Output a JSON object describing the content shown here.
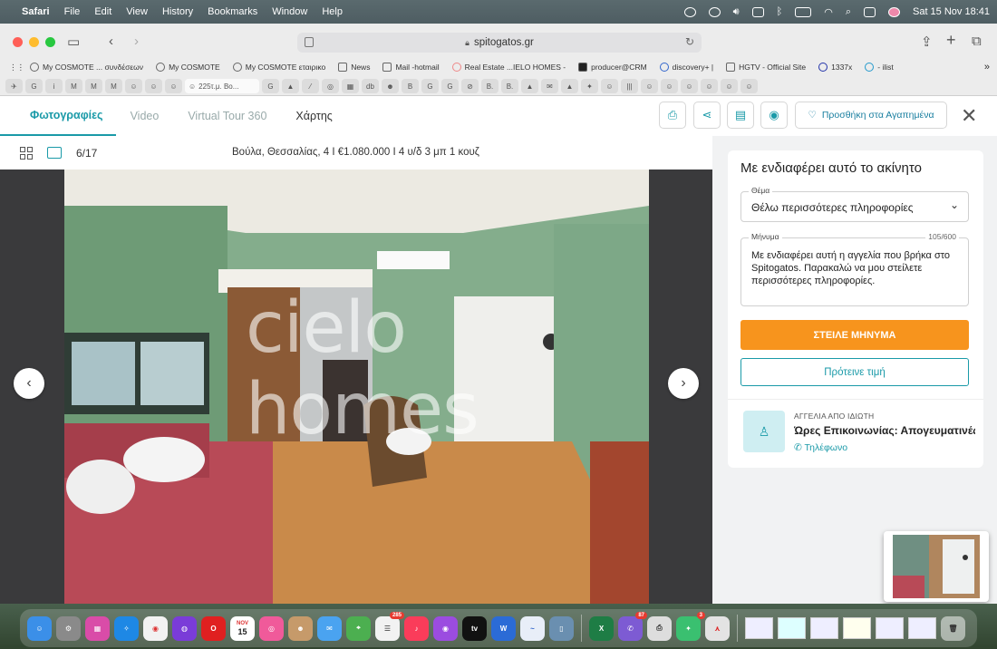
{
  "menubar": {
    "app": "Safari",
    "menus": [
      "File",
      "Edit",
      "View",
      "History",
      "Bookmarks",
      "Window",
      "Help"
    ],
    "datetime": "Sat 15 Nov  18:41"
  },
  "browser": {
    "url": "spitogatos.gr",
    "bookmarks": [
      "My COSMOTE ... συνδέσεων",
      "My COSMOTE",
      "My COSMOTE εταιρικο",
      "News",
      "Mail -hotmail",
      "Real Estate ...IELO HOMES -",
      "producer@CRM",
      "discovery+ |",
      "HGTV - Official Site",
      "1337x",
      "- ilist"
    ],
    "active_tab": "225τ.μ. Βο...",
    "tab_icons": [
      "G",
      "i",
      "M",
      "M",
      "M",
      "☺",
      "☺",
      "☺",
      "G",
      "▲",
      "⁄",
      "◎",
      "▦",
      "db",
      "☻",
      "B",
      "G",
      "G",
      "⊘",
      "B.",
      "B.",
      "▲",
      "✉",
      "▲",
      "✦",
      "☺",
      "|||",
      "☺",
      "☺",
      "☺",
      "☺",
      "☺",
      "☺"
    ]
  },
  "gallery": {
    "tabs": [
      "Φωτογραφίες",
      "Video",
      "Virtual Tour 360",
      "Χάρτης"
    ],
    "favorite_label": "Προσθήκη στα Αγαπημένα",
    "counter": "6/17",
    "summary": "Βούλα, Θεσσαλίας, 4  I  €1.080.000  I  4 υ/δ 3 μπ 1 κουζ",
    "watermark": "cielo homes"
  },
  "contact": {
    "title": "Με ενδιαφέρει αυτό το ακίνητο",
    "subject_label": "Θέμα",
    "subject_value": "Θέλω περισσότερες πληροφορίες",
    "message_label": "Μήνυμα",
    "message_count": "105/600",
    "message_text": "Με ενδιαφέρει αυτή η αγγελία που βρήκα στο Spitogatos. Παρακαλώ να μου στείλετε περισσότερες πληροφορίες.",
    "send_label": "ΣΤΕΙΛΕ ΜΗΝΥΜΑ",
    "offer_label": "Πρότεινε τιμή",
    "owner_type": "ΑΓΓΕΛΙΑ ΑΠΟ ΙΔΙΩΤΗ",
    "owner_hours": "Ώρες Επικοινωνίας: Απογευματινές",
    "phone_label": "Τηλέφωνο"
  },
  "dock": {
    "calendar_month": "NOV",
    "calendar_day": "15",
    "badges": {
      "reminders": "285",
      "viber": "87",
      "appstore": "3"
    }
  },
  "colors": {
    "accent": "#1a9aa8",
    "send": "#f7941d"
  }
}
